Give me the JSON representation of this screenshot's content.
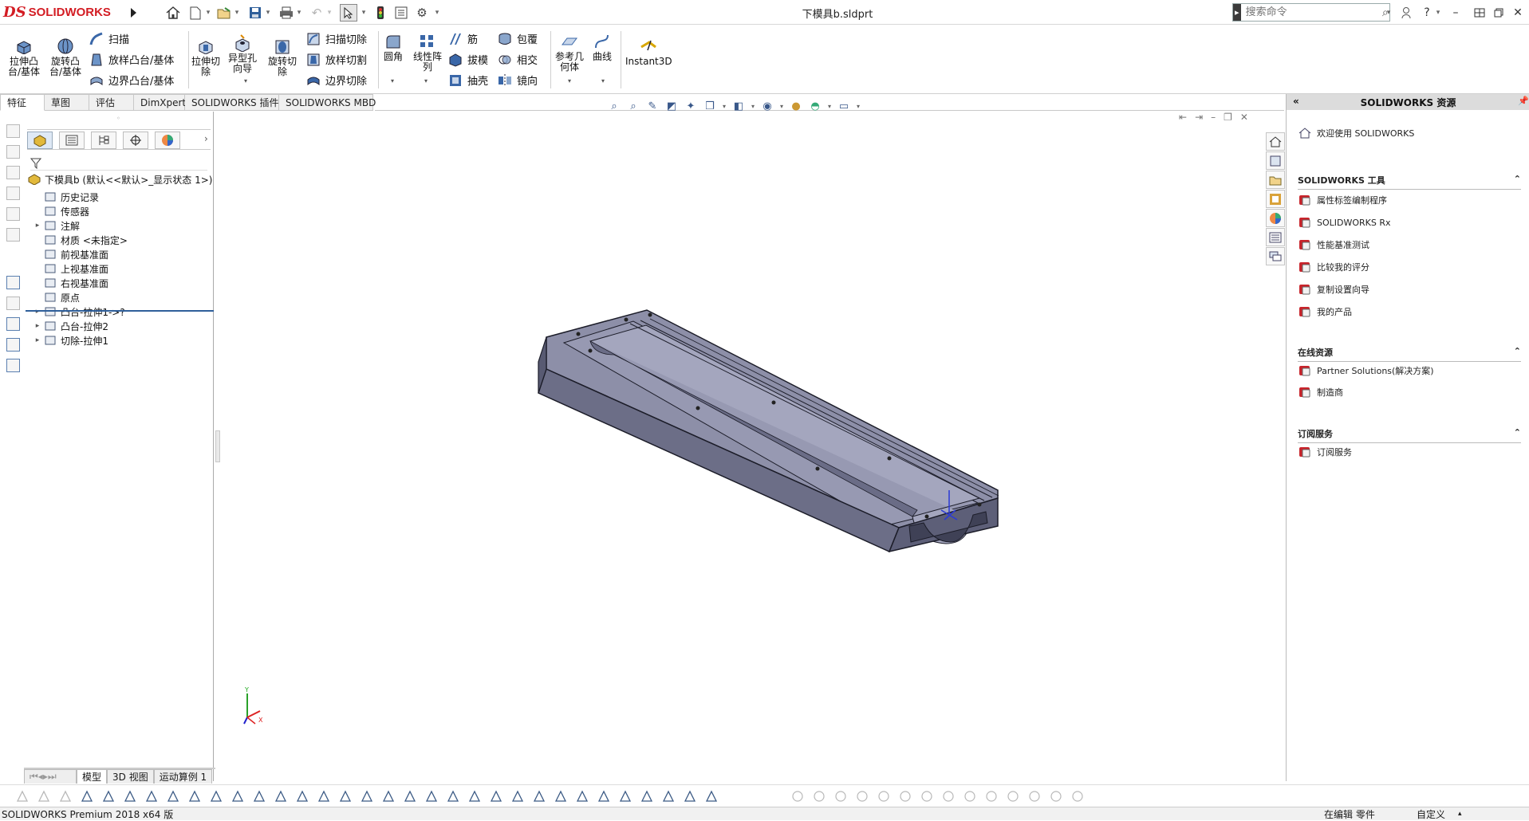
{
  "app": {
    "brand_prefix": "DS",
    "brand_name": "SOLIDWORKS",
    "document_title": "下模具b.sldprt"
  },
  "search": {
    "placeholder": "搜索命令"
  },
  "ribbon": {
    "extrude_boss": "拉伸凸\n台/基体",
    "revolve_boss": "旋转凸\n台/基体",
    "sweep": "扫描",
    "loft_boss": "放样凸台/基体",
    "boundary_boss": "边界凸台/基体",
    "extrude_cut": "拉伸切\n除",
    "hole_wizard": "异型孔\n向导",
    "revolve_cut": "旋转切\n除",
    "sweep_cut": "扫描切除",
    "loft_cut": "放样切割",
    "boundary_cut": "边界切除",
    "fillet": "圆角",
    "linear_pattern": "线性阵\n列",
    "rib": "筋",
    "draft": "拔模",
    "shell": "抽壳",
    "wrap": "包覆",
    "intersect": "相交",
    "mirror": "镜向",
    "ref_geometry": "参考几\n何体",
    "curves": "曲线",
    "instant3d": "Instant3D"
  },
  "tabs": [
    "特征",
    "草图",
    "评估",
    "DimXpert",
    "SOLIDWORKS 插件",
    "SOLIDWORKS MBD"
  ],
  "tree": {
    "root": "下模具b  (默认<<默认>_显示状态 1>)",
    "items": [
      {
        "label": "历史记录",
        "expandable": false
      },
      {
        "label": "传感器",
        "expandable": false
      },
      {
        "label": "注解",
        "expandable": true
      },
      {
        "label": "材质 <未指定>",
        "expandable": false
      },
      {
        "label": "前视基准面",
        "expandable": false
      },
      {
        "label": "上视基准面",
        "expandable": false
      },
      {
        "label": "右视基准面",
        "expandable": false
      },
      {
        "label": "原点",
        "expandable": false
      },
      {
        "label": "凸台-拉伸1->?",
        "expandable": true
      },
      {
        "label": "凸台-拉伸2",
        "expandable": true
      },
      {
        "label": "切除-拉伸1",
        "expandable": true
      }
    ]
  },
  "model_tabs": [
    "模型",
    "3D 视图",
    "运动算例 1"
  ],
  "status": {
    "product": "SOLIDWORKS Premium 2018 x64 版",
    "edit_mode": "在编辑 零件",
    "units": "自定义"
  },
  "taskpane": {
    "title": "SOLIDWORKS 资源",
    "welcome": "欢迎使用 SOLIDWORKS",
    "tools_header": "SOLIDWORKS 工具",
    "tools": [
      "属性标签编制程序",
      "SOLIDWORKS Rx",
      "性能基准测试",
      "比较我的评分",
      "复制设置向导",
      "我的产品"
    ],
    "online_header": "在线资源",
    "online": [
      "Partner Solutions(解决方案)",
      "制造商"
    ],
    "subscription_header": "订阅服务",
    "subscription": [
      "订阅服务"
    ]
  },
  "colors": {
    "brand_red": "#d31c23",
    "model_top": "#8d8fa8",
    "model_side": "#5d5f78",
    "model_edge": "#1b1c28",
    "accent_blue": "#39588a"
  }
}
